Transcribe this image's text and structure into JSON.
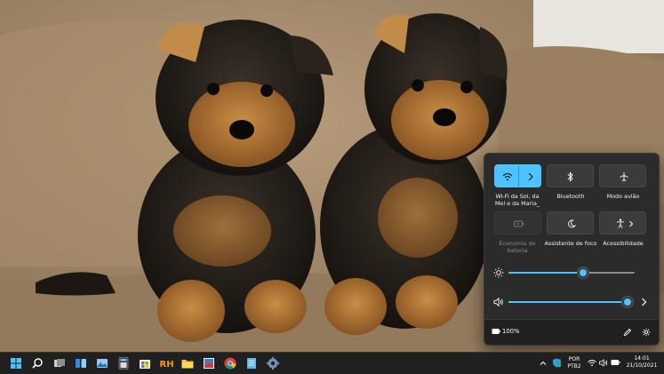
{
  "quick_settings": {
    "tiles": [
      {
        "label": "Wi-Fi da Sol, da Mel e da Maria_",
        "icon": "wifi-icon",
        "state": "on"
      },
      {
        "label": "Bluetooth",
        "icon": "bluetooth-icon",
        "state": "off"
      },
      {
        "label": "Modo avião",
        "icon": "airplane-icon",
        "state": "off"
      },
      {
        "label": "Economia de bateria",
        "icon": "battery-saver-icon",
        "state": "disabled"
      },
      {
        "label": "Assistente de foco",
        "icon": "moon-icon",
        "state": "off"
      },
      {
        "label": "Acessibilidade",
        "icon": "accessibility-icon",
        "state": "off"
      }
    ],
    "brightness_level": 0.59,
    "volume_level": 0.96,
    "battery_text": "100%",
    "accent_color": "#4cc2ff"
  },
  "taskbar": {
    "icons": [
      "windows-start-icon",
      "search-icon",
      "task-view-icon",
      "widgets-icon",
      "photos-icon",
      "calculator-icon",
      "store-icon",
      "rh-app-icon",
      "file-explorer-icon",
      "image-app-icon",
      "chrome-icon",
      "notepad-icon",
      "settings-icon"
    ],
    "language": "POR",
    "keyboard": "PTB2",
    "time": "14:01",
    "date": "21/10/2021"
  }
}
